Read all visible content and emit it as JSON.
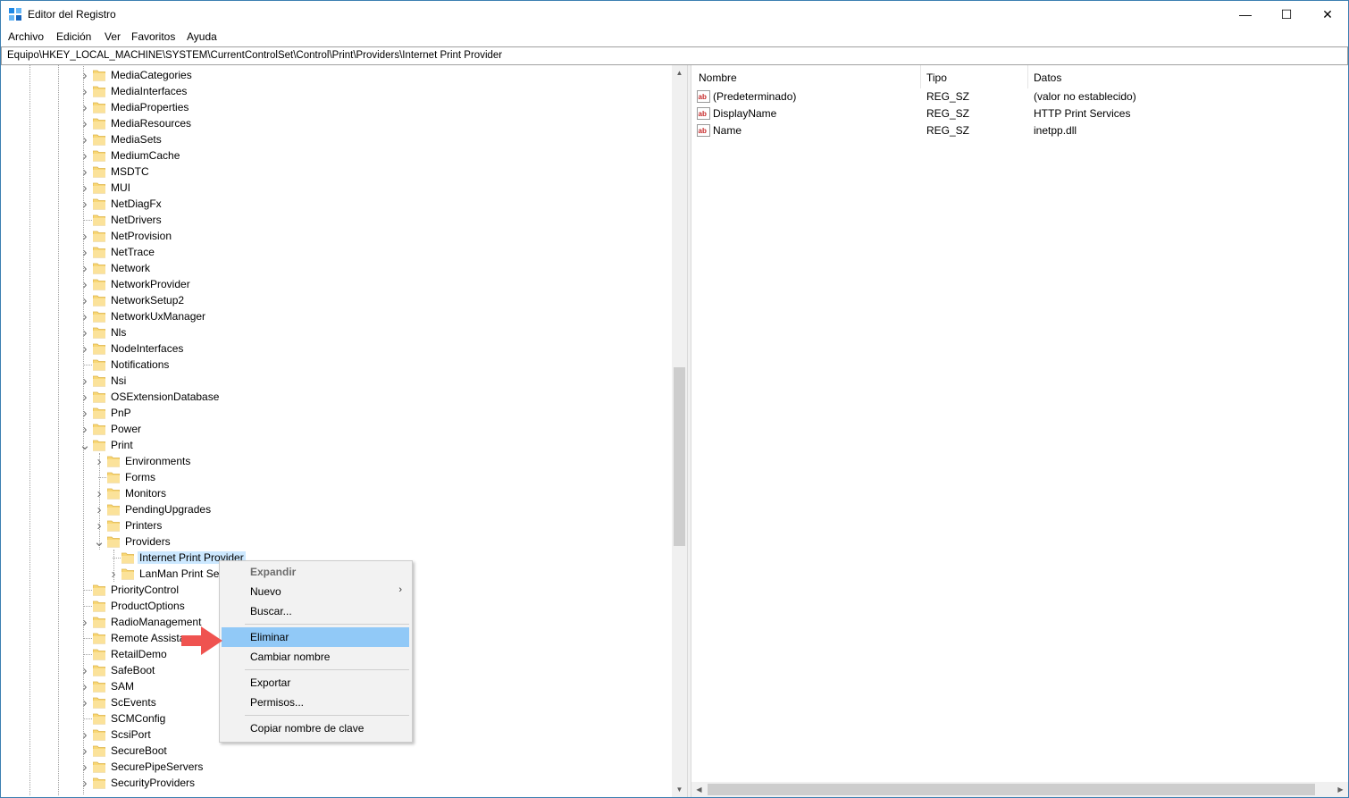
{
  "window": {
    "title": "Editor del Registro",
    "controls": {
      "minimize": "—",
      "maximize": "☐",
      "close": "✕"
    }
  },
  "menu": [
    "Archivo",
    "Edición",
    "Ver",
    "Favoritos",
    "Ayuda"
  ],
  "address": "Equipo\\HKEY_LOCAL_MACHINE\\SYSTEM\\CurrentControlSet\\Control\\Print\\Providers\\Internet Print Provider",
  "tree": [
    {
      "label": "MediaCategories",
      "level": 0,
      "expander": ">"
    },
    {
      "label": "MediaInterfaces",
      "level": 0,
      "expander": ">"
    },
    {
      "label": "MediaProperties",
      "level": 0,
      "expander": ">"
    },
    {
      "label": "MediaResources",
      "level": 0,
      "expander": ">"
    },
    {
      "label": "MediaSets",
      "level": 0,
      "expander": ">"
    },
    {
      "label": "MediumCache",
      "level": 0,
      "expander": ">"
    },
    {
      "label": "MSDTC",
      "level": 0,
      "expander": ">"
    },
    {
      "label": "MUI",
      "level": 0,
      "expander": ">"
    },
    {
      "label": "NetDiagFx",
      "level": 0,
      "expander": ">"
    },
    {
      "label": "NetDrivers",
      "level": 0,
      "expander": ""
    },
    {
      "label": "NetProvision",
      "level": 0,
      "expander": ">"
    },
    {
      "label": "NetTrace",
      "level": 0,
      "expander": ">"
    },
    {
      "label": "Network",
      "level": 0,
      "expander": ">"
    },
    {
      "label": "NetworkProvider",
      "level": 0,
      "expander": ">"
    },
    {
      "label": "NetworkSetup2",
      "level": 0,
      "expander": ">"
    },
    {
      "label": "NetworkUxManager",
      "level": 0,
      "expander": ">"
    },
    {
      "label": "Nls",
      "level": 0,
      "expander": ">"
    },
    {
      "label": "NodeInterfaces",
      "level": 0,
      "expander": ">"
    },
    {
      "label": "Notifications",
      "level": 0,
      "expander": ""
    },
    {
      "label": "Nsi",
      "level": 0,
      "expander": ">"
    },
    {
      "label": "OSExtensionDatabase",
      "level": 0,
      "expander": ">"
    },
    {
      "label": "PnP",
      "level": 0,
      "expander": ">"
    },
    {
      "label": "Power",
      "level": 0,
      "expander": ">"
    },
    {
      "label": "Print",
      "level": 0,
      "expander": "v"
    },
    {
      "label": "Environments",
      "level": 1,
      "expander": ">"
    },
    {
      "label": "Forms",
      "level": 1,
      "expander": ""
    },
    {
      "label": "Monitors",
      "level": 1,
      "expander": ">"
    },
    {
      "label": "PendingUpgrades",
      "level": 1,
      "expander": ">"
    },
    {
      "label": "Printers",
      "level": 1,
      "expander": ">"
    },
    {
      "label": "Providers",
      "level": 1,
      "expander": "v"
    },
    {
      "label": "Internet Print Provider",
      "level": 2,
      "expander": "",
      "selected": true
    },
    {
      "label": "LanMan Print Services",
      "level": 2,
      "expander": ">"
    },
    {
      "label": "PriorityControl",
      "level": 0,
      "expander": ""
    },
    {
      "label": "ProductOptions",
      "level": 0,
      "expander": ""
    },
    {
      "label": "RadioManagement",
      "level": 0,
      "expander": ">"
    },
    {
      "label": "Remote Assistance",
      "level": 0,
      "expander": ""
    },
    {
      "label": "RetailDemo",
      "level": 0,
      "expander": ""
    },
    {
      "label": "SafeBoot",
      "level": 0,
      "expander": ">"
    },
    {
      "label": "SAM",
      "level": 0,
      "expander": ">"
    },
    {
      "label": "ScEvents",
      "level": 0,
      "expander": ">"
    },
    {
      "label": "SCMConfig",
      "level": 0,
      "expander": ""
    },
    {
      "label": "ScsiPort",
      "level": 0,
      "expander": ">"
    },
    {
      "label": "SecureBoot",
      "level": 0,
      "expander": ">"
    },
    {
      "label": "SecurePipeServers",
      "level": 0,
      "expander": ">"
    },
    {
      "label": "SecurityProviders",
      "level": 0,
      "expander": ">"
    }
  ],
  "columns": {
    "name": "Nombre",
    "type": "Tipo",
    "data": "Datos"
  },
  "values": [
    {
      "name": "(Predeterminado)",
      "type": "REG_SZ",
      "data": "(valor no establecido)"
    },
    {
      "name": "DisplayName",
      "type": "REG_SZ",
      "data": "HTTP Print Services"
    },
    {
      "name": "Name",
      "type": "REG_SZ",
      "data": "inetpp.dll"
    }
  ],
  "context_menu": {
    "expand": "Expandir",
    "new": "Nuevo",
    "find": "Buscar...",
    "delete": "Eliminar",
    "rename": "Cambiar nombre",
    "export": "Exportar",
    "permissions": "Permisos...",
    "copy_key_name": "Copiar nombre de clave"
  },
  "icons": {
    "app": "registry-editor-icon",
    "folder": "folder-icon",
    "value": "string-value-icon",
    "annotation": "red-arrow-icon"
  },
  "colors": {
    "selection": "#cce8ff",
    "menu_highlight": "#91c9f7",
    "folder": "#f8d775",
    "arrow": "#ef5350"
  }
}
